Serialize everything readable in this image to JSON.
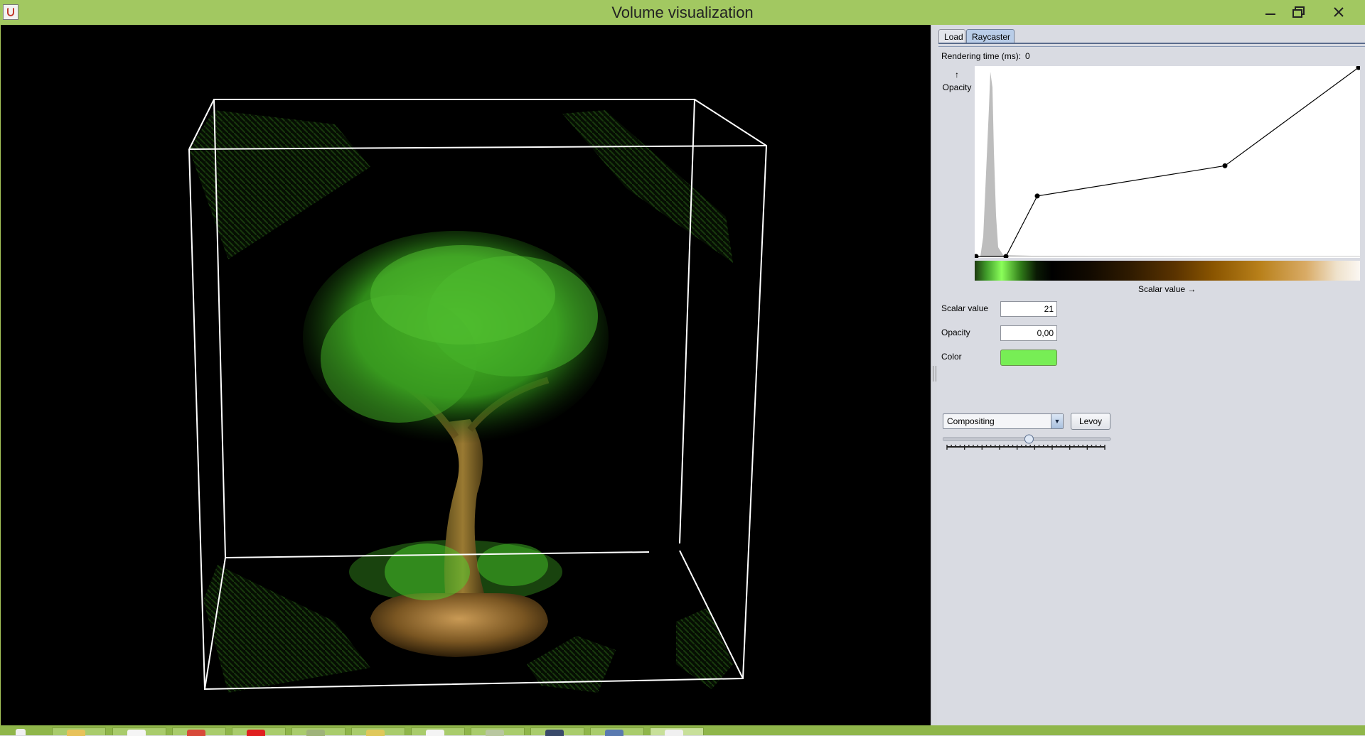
{
  "window": {
    "title": "Volume visualization",
    "minimize_glyph": "—",
    "maximize_glyph": "❐",
    "close_glyph": "✕"
  },
  "tabs": [
    {
      "label": "Load",
      "selected": false
    },
    {
      "label": "Raycaster",
      "selected": true
    }
  ],
  "raycaster": {
    "rendering_time_label": "Rendering time (ms):",
    "rendering_time_value": "0",
    "opacity_axis_arrow": "↑",
    "opacity_axis_label": "Opacity",
    "scalar_axis_label": "Scalar value →",
    "transfer_function": {
      "control_points": [
        {
          "scalar": 0,
          "opacity": 0.0
        },
        {
          "scalar": 21,
          "opacity": 0.0
        },
        {
          "scalar": 43,
          "opacity": 0.32
        },
        {
          "scalar": 175,
          "opacity": 0.48
        },
        {
          "scalar": 269,
          "opacity": 1.0
        }
      ],
      "scalar_max": 269,
      "point_color": "#000000",
      "line_color": "#000000",
      "histogram_color": "#bdbdbd"
    },
    "fields": {
      "scalar_label": "Scalar value",
      "scalar_value": "21",
      "opacity_label": "Opacity",
      "opacity_value": "0,00",
      "color_label": "Color",
      "color_value": "#77ee55"
    },
    "render_mode": {
      "selected": "Compositing",
      "arrow": "▼"
    },
    "levoy_button": "Levoy",
    "slider": {
      "value": 0.52,
      "tick_count": 37
    }
  },
  "colors": {
    "title_bar": "#a2c861",
    "panel_bg": "#d9dbe2",
    "viewport_bg": "#000000",
    "tab_selected": "#b9cde8"
  },
  "viewport": {
    "content": "volume-rendered-bonsai-tree",
    "bounding_box_color": "#ffffff"
  },
  "taskbar": {
    "icons": [
      "start-icon",
      "explorer-icon",
      "notepad-icon",
      "chrome-icon",
      "acrobat-icon",
      "app-icon-1",
      "app-icon-2",
      "app-icon-3",
      "app-icon-4",
      "app-icon-5",
      "app-icon-6",
      "java-app-icon"
    ]
  }
}
